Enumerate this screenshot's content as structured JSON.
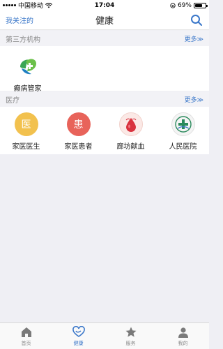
{
  "status_bar": {
    "carrier": "中国移动",
    "time": "17:04",
    "battery": "69%",
    "battery_level": 0.69
  },
  "nav": {
    "left_label": "我关注的",
    "title": "健康",
    "search_icon": "search-icon"
  },
  "third_party": {
    "title": "第三方机构",
    "more": "更多≫",
    "items": [
      {
        "label": "癫病管家",
        "icon": "leaf-cross-icon"
      }
    ]
  },
  "medical": {
    "title": "医疗",
    "more": "更多≫",
    "items": [
      {
        "label": "家医医生",
        "icon": "doctor-icon",
        "glyph": "医",
        "color": "#f2c14e"
      },
      {
        "label": "家医患者",
        "icon": "patient-icon",
        "glyph": "患",
        "color": "#e8635a"
      },
      {
        "label": "廊坊献血",
        "icon": "blood-drop-icon",
        "color": "#d9333f"
      },
      {
        "label": "人民医院",
        "icon": "hospital-logo-icon",
        "color": "#2a8a5c"
      }
    ]
  },
  "tabs": [
    {
      "label": "首页",
      "icon": "home-icon"
    },
    {
      "label": "健康",
      "icon": "heart-icon",
      "active": true
    },
    {
      "label": "服务",
      "icon": "star-icon"
    },
    {
      "label": "我的",
      "icon": "user-icon"
    }
  ],
  "colors": {
    "accent": "#3a77c9",
    "background": "#efeff4"
  }
}
